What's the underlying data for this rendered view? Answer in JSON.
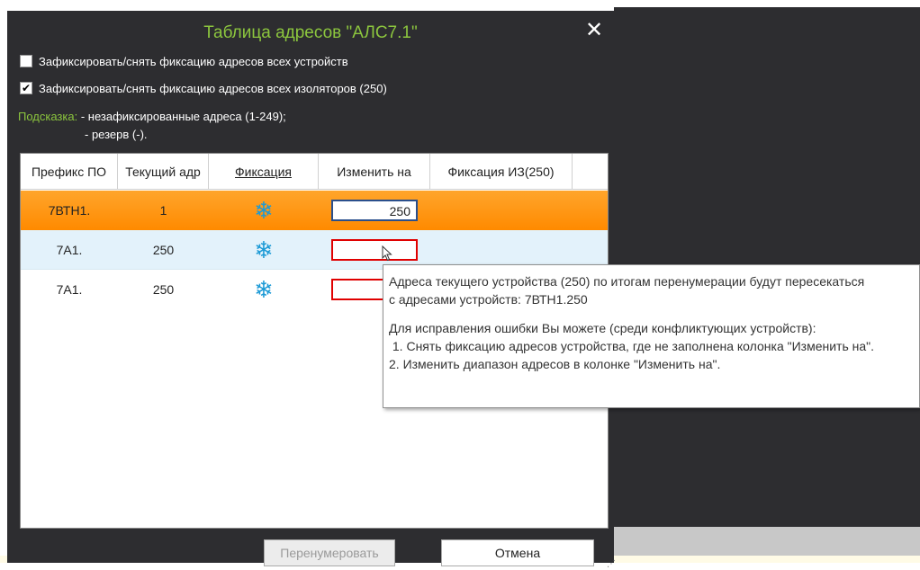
{
  "dialog": {
    "title": "Таблица адресов \"АЛС7.1\"",
    "close_glyph": "✕",
    "checkbox_devices": {
      "label": "Зафиксировать/снять фиксацию адресов всех устройств",
      "checked": false
    },
    "checkbox_isolators": {
      "label": "Зафиксировать/снять фиксацию адресов всех изоляторов (250)",
      "checked": true,
      "mark": "✔"
    },
    "hint": {
      "label": "Подсказка:",
      "line1": " - незафиксированные адреса (1-249);",
      "line2": "- резерв (-)."
    }
  },
  "table": {
    "columns": [
      "Префикс ПО",
      "Текущий адр",
      "Фиксация",
      "Изменить на",
      "Фиксация ИЗ(250)"
    ],
    "rows": [
      {
        "prefix": "7ВТН1.",
        "current": "1",
        "fixed_icon": "snowflake-icon",
        "change_to": "250",
        "state": "selected"
      },
      {
        "prefix": "7А1.",
        "current": "250",
        "fixed_icon": "snowflake-icon",
        "change_to": "",
        "state": "error"
      },
      {
        "prefix": "7А1.",
        "current": "250",
        "fixed_icon": "snowflake-icon",
        "change_to": "",
        "state": "error"
      }
    ]
  },
  "buttons": {
    "renumber": "Перенумеровать",
    "cancel": "Отмена"
  },
  "tooltip": {
    "line1": "Адреса текущего устройства (250) по итогам перенумерации будут пересекаться",
    "line2": "с адресами устройств: 7ВТН1.250",
    "line3": "Для исправления ошибки Вы можете (среди конфликтующих устройств):",
    "line4": " 1. Снять фиксацию адресов устройства, где не заполнена колонка \"Изменить на\".",
    "line5": "2. Изменить диапазон адресов в колонке \"Изменить на\"."
  },
  "icons": {
    "snowflake": "❄"
  },
  "colors": {
    "accent_green": "#8cc63e",
    "selected_row": "#ff8a00",
    "error_border": "#e00000",
    "snowflake": "#1c9ad6"
  }
}
